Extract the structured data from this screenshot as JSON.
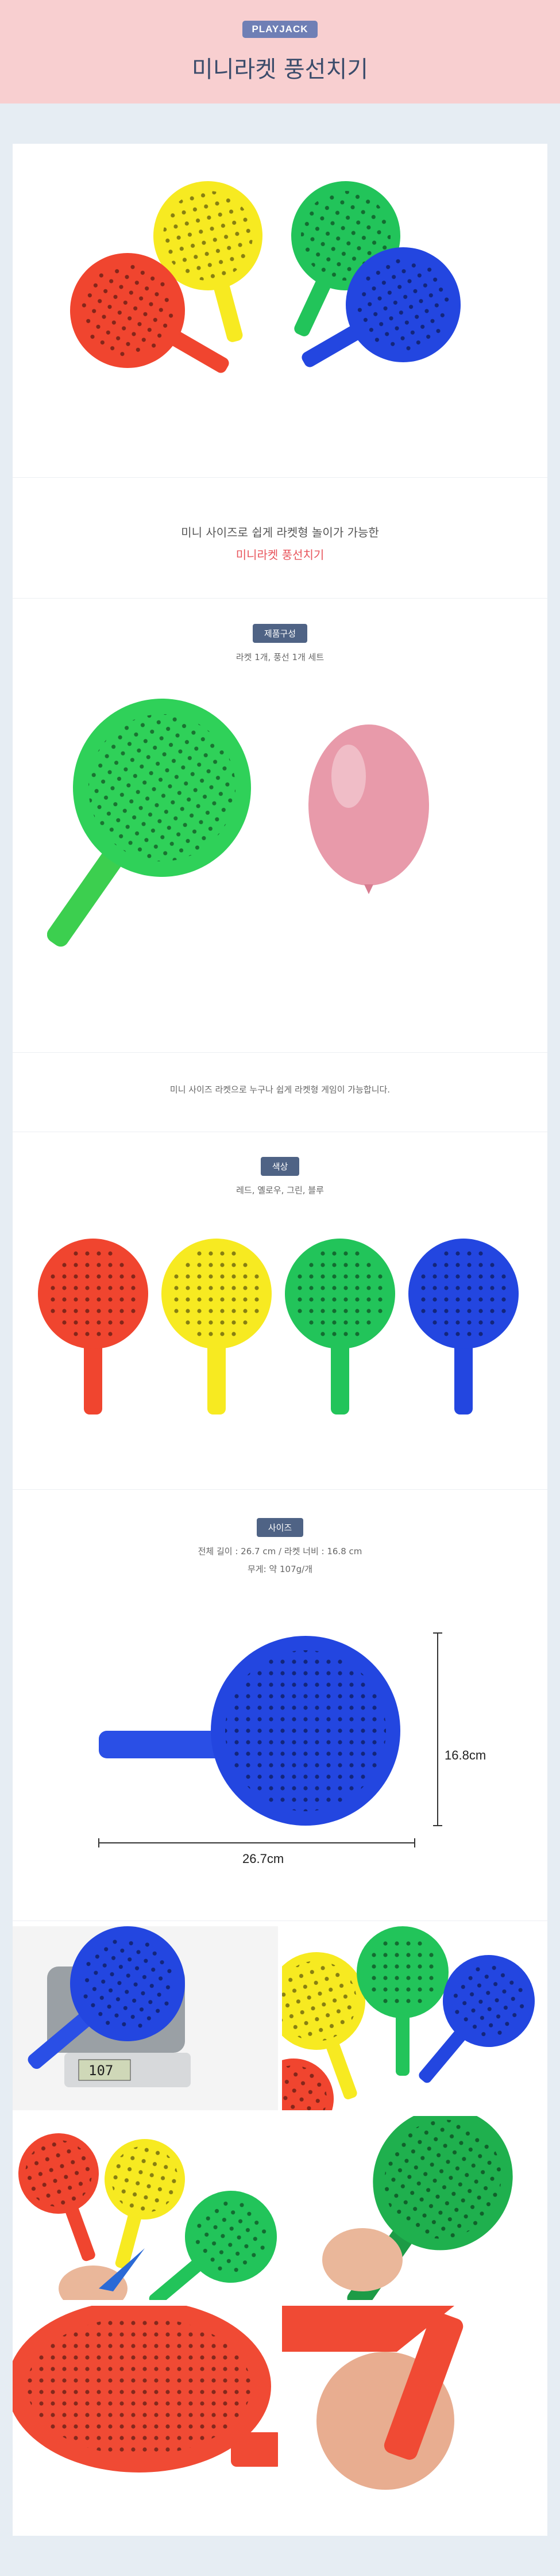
{
  "header": {
    "brand": "PLAYJACK",
    "title": "미니라켓 풍선치기"
  },
  "intro": {
    "line1": "미니 사이즈로 쉽게 라켓형 놀이가 가능한",
    "line2": "미니라켓 풍선치기"
  },
  "components": {
    "badge": "제품구성",
    "text": "라켓 1개, 풍선 1개 세트"
  },
  "desc": {
    "text": "미니 사이즈 라켓으로 누구나 쉽게 라켓형 게임이 가능합니다."
  },
  "colors_section": {
    "badge": "색상",
    "text": "레드, 옐로우, 그린, 블루"
  },
  "size_section": {
    "badge": "사이즈",
    "text": "전체 길이 : 26.7 cm / 라켓 너비 : 16.8 cm",
    "weight": "무게: 약 107g/개",
    "width_label": "16.8cm",
    "length_label": "26.7cm"
  },
  "scale": {
    "reading": "107"
  },
  "colors": {
    "red": "#f0452f",
    "yellow": "#f7ea21",
    "green": "#22c45a",
    "blue": "#2346e0",
    "pink": "#e89aaa"
  },
  "icons": [
    "racket-icon",
    "balloon-icon",
    "dimension-arrow-icon"
  ]
}
